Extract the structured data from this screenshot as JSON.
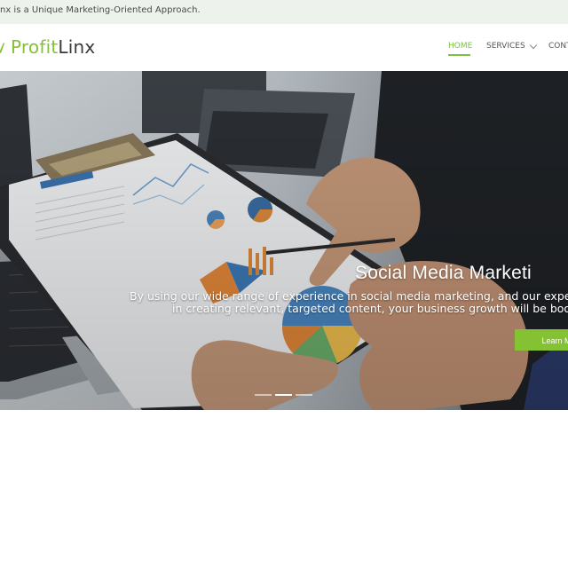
{
  "announcement": {
    "text": "nx is a Unique Marketing-Oriented Approach."
  },
  "header": {
    "logo_part1": "Profit",
    "logo_part2": "Linx",
    "nav": [
      {
        "label": "HOME",
        "active": true
      },
      {
        "label": "SERVICES",
        "has_dropdown": true
      },
      {
        "label": "CONT"
      }
    ]
  },
  "hero": {
    "title": "Social Media Marketi",
    "description_line1": "By using our wide range of experience in social media marketing, and our expe",
    "description_line2": "in creating relevant, targeted content, your business growth will be boo",
    "button_label": "Learn Mo",
    "slides": 3,
    "active_slide": 2
  },
  "colors": {
    "accent": "#84c233",
    "topbar_bg": "#eef2ec"
  }
}
